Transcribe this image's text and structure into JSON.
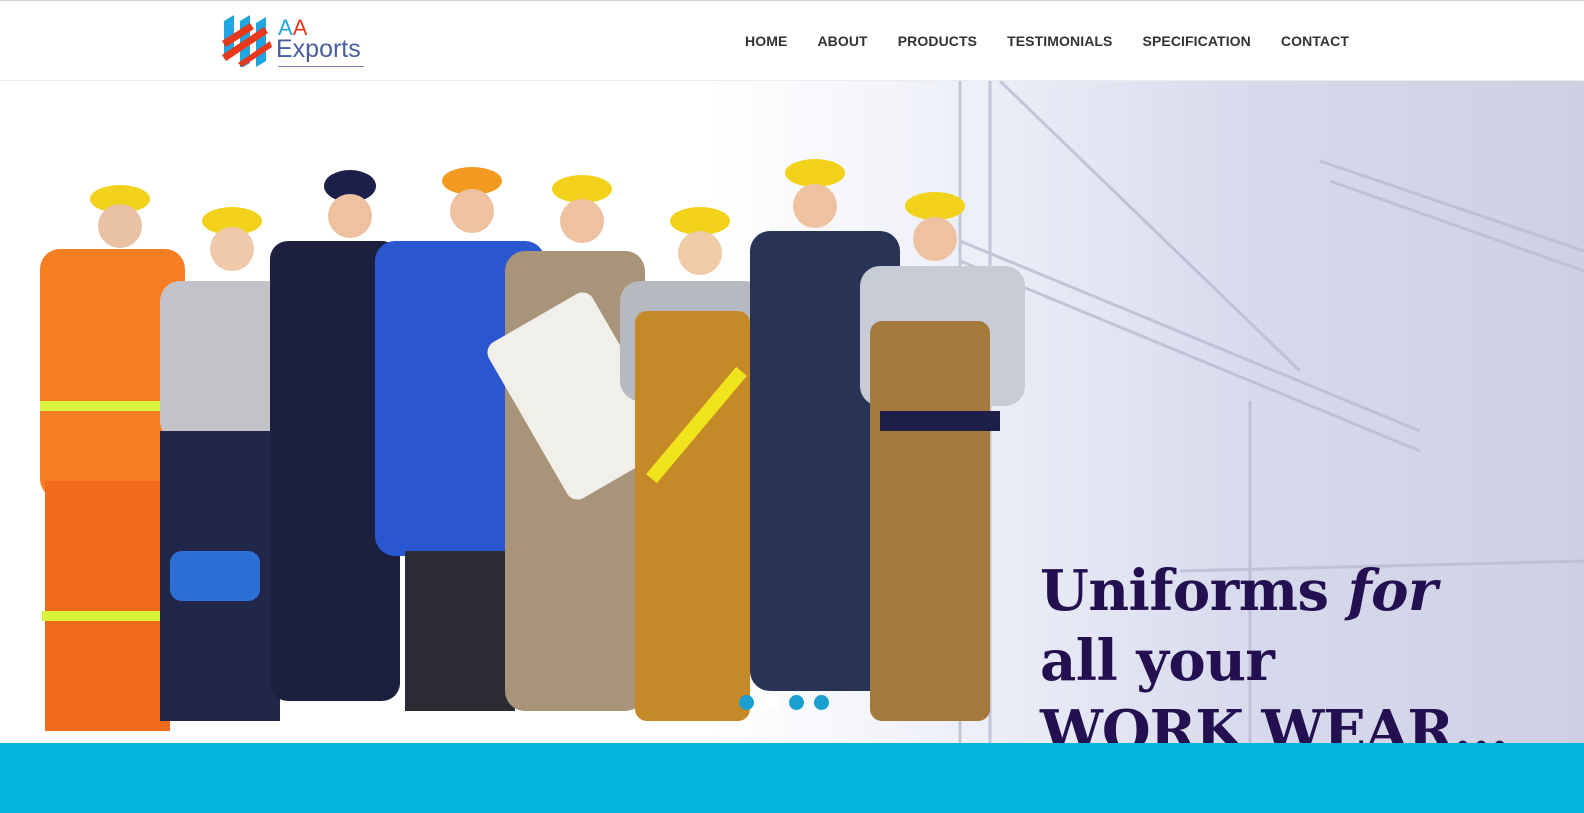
{
  "brand": {
    "logo_aa_1": "A",
    "logo_aa_2": "A",
    "logo_exports": "Exports",
    "colors": {
      "blue": "#1fa6e0",
      "red": "#e8381c",
      "navy": "#4a5fa0"
    }
  },
  "nav": {
    "items": [
      {
        "label": "HOME"
      },
      {
        "label": "ABOUT"
      },
      {
        "label": "PRODUCTS"
      },
      {
        "label": "TESTIMONIALS"
      },
      {
        "label": "SPECIFICATION"
      },
      {
        "label": "CONTACT"
      }
    ]
  },
  "hero": {
    "headline_word1": "Uniforms",
    "headline_word2": "for",
    "headline_line2": "all your",
    "headline_line3": "WORK WEAR...",
    "headline_color": "#241050",
    "slides_total": 4,
    "active_slide": 2
  },
  "band": {
    "color": "#04b5dc"
  }
}
